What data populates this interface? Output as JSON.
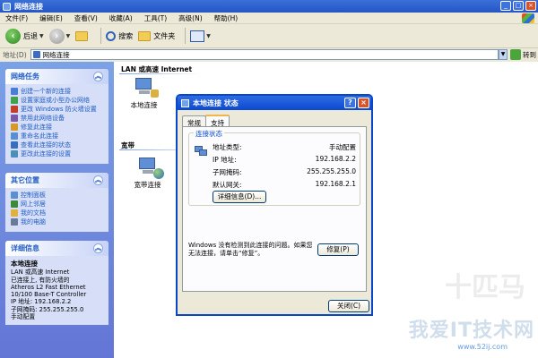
{
  "window": {
    "title": "网络连接",
    "minimize": "_",
    "maximize": "□",
    "close": "×"
  },
  "menu": [
    "文件(F)",
    "编辑(E)",
    "查看(V)",
    "收藏(A)",
    "工具(T)",
    "高级(N)",
    "帮助(H)"
  ],
  "toolbar": {
    "back": "后退",
    "search": "搜索",
    "folders": "文件夹"
  },
  "address": {
    "label": "地址(D)",
    "value": "网络连接",
    "go": "转到"
  },
  "tasks": {
    "title": "网络任务",
    "items": [
      "创建一个新的连接",
      "设置家庭或小型办公网络",
      "更改 Windows 防火墙设置",
      "禁用此网络设备",
      "修复此连接",
      "重命名此连接",
      "查看此连接的状态",
      "更改此连接的设置"
    ],
    "icon_colors": [
      "#4a7ed6",
      "#3fa34d",
      "#c2402b",
      "#7a5aa8",
      "#d49a2a",
      "#5a8fd0",
      "#3a6fc0",
      "#4a90b8"
    ]
  },
  "other": {
    "title": "其它位置",
    "items": [
      "控制面板",
      "网上邻居",
      "我的文档",
      "我的电脑"
    ],
    "icon_colors": [
      "#5a8fd0",
      "#3a8a3a",
      "#e0b040",
      "#6a7a9a"
    ]
  },
  "details": {
    "title": "详细信息",
    "name": "本地连接",
    "lines": [
      "LAN 或高速 Internet",
      "已连接上, 有防火墙的",
      "Atheros L2 Fast Ethernet",
      "10/100 Base-T Controller",
      "IP 地址: 192.168.2.2",
      "子网掩码: 255.255.255.0",
      "手动配置"
    ]
  },
  "main": {
    "group1": "LAN 或高速 Internet",
    "conn1": "本地连接",
    "group2": "宽带",
    "conn2": "宽带连接"
  },
  "dialog": {
    "title": "本地连接 状态",
    "help": "?",
    "close": "×",
    "tabs": [
      "常规",
      "支持"
    ],
    "group_title": "连接状态",
    "rows": [
      {
        "label": "地址类型:",
        "value": "手动配置"
      },
      {
        "label": "IP 地址:",
        "value": "192.168.2.2"
      },
      {
        "label": "子网掩码:",
        "value": "255.255.255.0"
      },
      {
        "label": "默认网关:",
        "value": "192.168.2.1"
      }
    ],
    "details_button": "详细信息(D)...",
    "diagnose_text": "Windows 没有检测到此连接的问题。如果您无法连接，请单击“修复”。",
    "repair_button": "修复(P)",
    "close_button": "关闭(C)"
  },
  "watermark": {
    "brand": "我爱IT技术网",
    "url": "www.52ij.com",
    "faint": "十匹马"
  }
}
